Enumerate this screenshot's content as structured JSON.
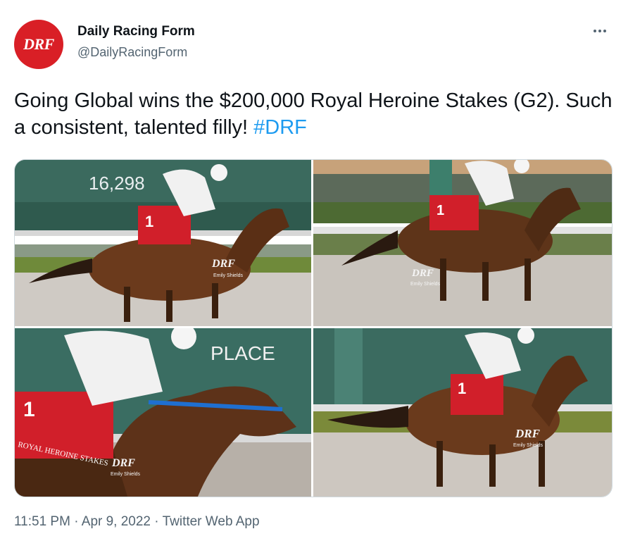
{
  "account": {
    "avatar_text": "DRF",
    "display_name": "Daily Racing Form",
    "handle": "@DailyRacingForm"
  },
  "tweet": {
    "text": "Going Global wins the $200,000 Royal Heroine Stakes (G2). Such a consistent, talented filly! ",
    "hashtag": "#DRF"
  },
  "photos": {
    "p1": {
      "board": "16,298",
      "saddle_number": "1",
      "watermark": "DRF",
      "credit": "Emily Shields"
    },
    "p2": {
      "saddle_number": "1",
      "watermark": "DRF",
      "credit": "Emily Shields"
    },
    "p3": {
      "board": "PLACE",
      "saddle_number": "1",
      "saddle_text": "ROYAL HEROINE STAKES",
      "watermark": "DRF",
      "credit": "Emily Shields"
    },
    "p4": {
      "saddle_number": "1",
      "watermark": "DRF",
      "credit": "Emily Shields"
    }
  },
  "footer": {
    "time": "11:51 PM",
    "sep": " · ",
    "date": "Apr 9, 2022",
    "source": "Twitter Web App"
  },
  "colors": {
    "accent": "#1d9bf0",
    "brand": "#d91f26",
    "secondary_text": "#536471"
  }
}
